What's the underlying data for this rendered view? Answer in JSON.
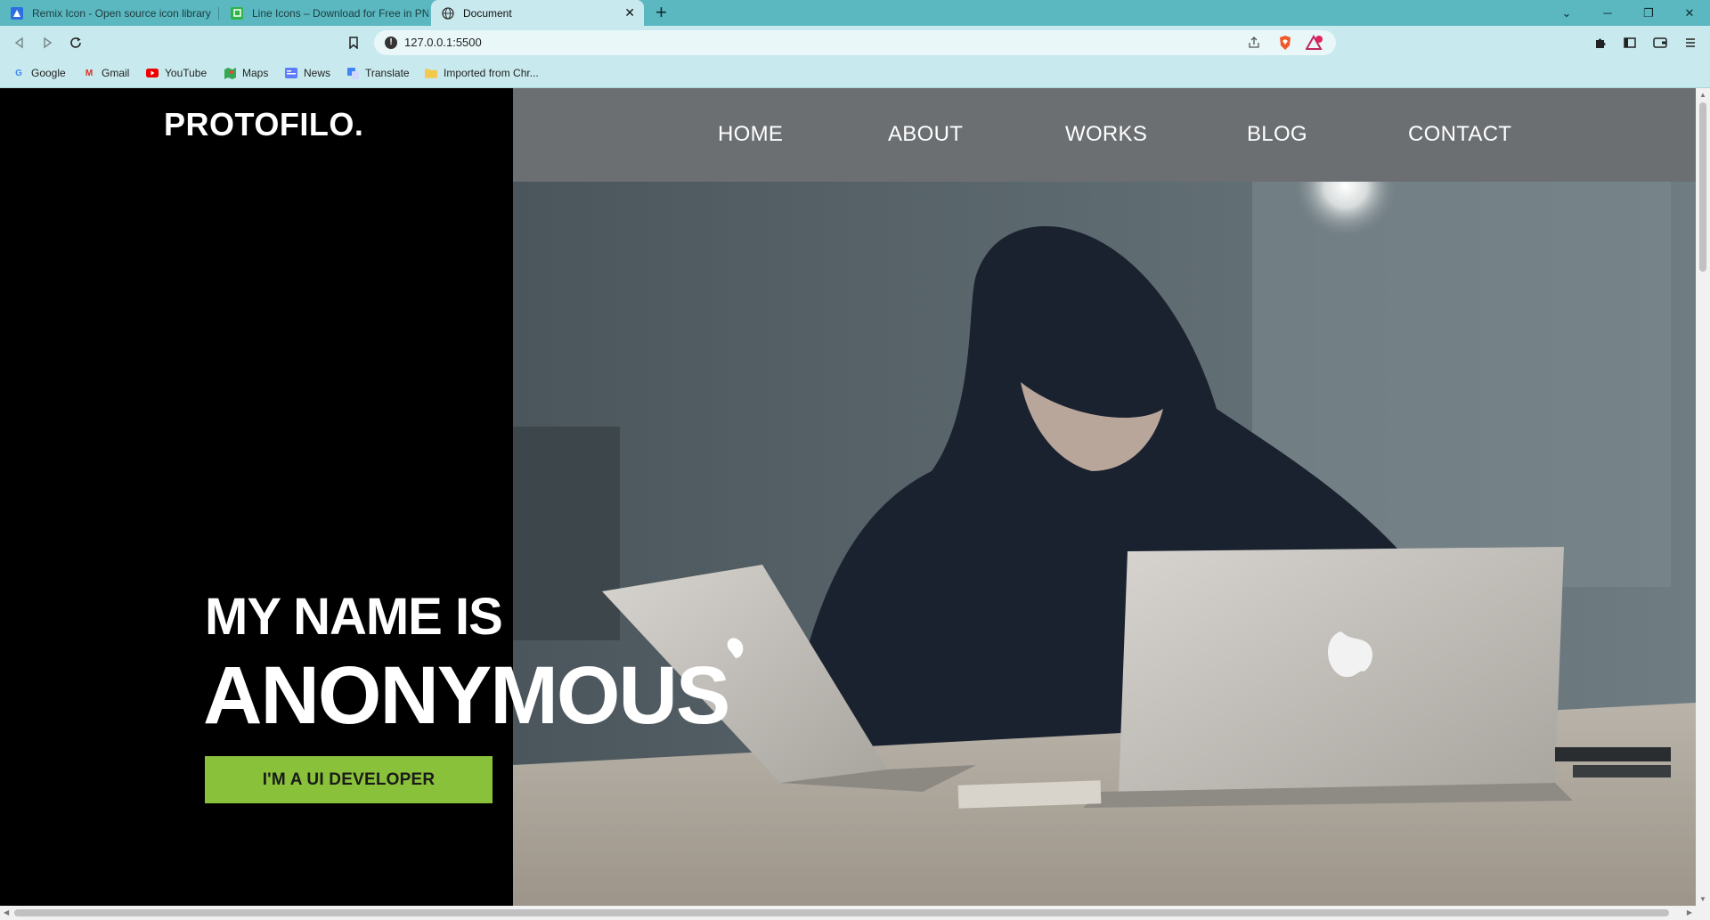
{
  "browser": {
    "tabs": [
      {
        "title": "Remix Icon - Open source icon library",
        "icon": "remix-icon-favicon",
        "active": false
      },
      {
        "title": "Line Icons – Download for Free in PNG",
        "icon": "line-icons-favicon",
        "active": false
      },
      {
        "title": "Document",
        "icon": "globe-icon",
        "active": true
      }
    ],
    "url": "127.0.0.1:5500",
    "bookmarks": [
      {
        "label": "Google",
        "icon": "google-icon"
      },
      {
        "label": "Gmail",
        "icon": "gmail-icon"
      },
      {
        "label": "YouTube",
        "icon": "youtube-icon"
      },
      {
        "label": "Maps",
        "icon": "maps-icon"
      },
      {
        "label": "News",
        "icon": "news-icon"
      },
      {
        "label": "Translate",
        "icon": "translate-icon"
      },
      {
        "label": "Imported from Chr...",
        "icon": "folder-icon"
      }
    ],
    "colors": {
      "chrome": "#5bb8c0",
      "toolbar": "#c8eaee"
    }
  },
  "site": {
    "logo": "PROTOFILO.",
    "nav": [
      "HOME",
      "ABOUT",
      "WORKS",
      "BLOG",
      "CONTACT"
    ],
    "hero": {
      "line1": "MY NAME IS",
      "line2": "ANONYMOUS",
      "cta": "I'M A UI DEVELOPER"
    },
    "colors": {
      "accent": "#89c13a",
      "nav_bg": "#6b6f72",
      "left_bg": "#000000"
    }
  }
}
